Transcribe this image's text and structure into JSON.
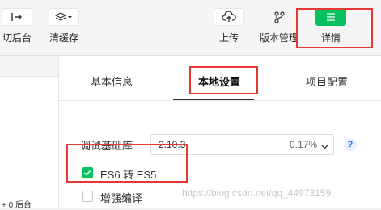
{
  "toolbar": {
    "switch_background": {
      "label": "切后台",
      "icon": "switch-background-icon"
    },
    "clear_cache": {
      "label": "清缓存",
      "icon": "layers-dropdown-icon"
    },
    "upload": {
      "label": "上传",
      "icon": "cloud-upload-icon"
    },
    "version_management": {
      "label": "版本管理",
      "icon": "branch-icon"
    },
    "details": {
      "label": "详情",
      "icon": "menu-icon",
      "active": true
    }
  },
  "left_fragment": "+ 0 后台",
  "panel": {
    "tabs": [
      {
        "label": "基本信息"
      },
      {
        "label": "本地设置",
        "active": true
      },
      {
        "label": "项目配置"
      }
    ],
    "base_library": {
      "label": "调试基础库",
      "version": "2.10.3",
      "percent": "0.17%",
      "help": "?"
    },
    "options": [
      {
        "label": "ES6 转 ES5",
        "checked": true
      },
      {
        "label": "增强编译",
        "checked": false
      }
    ]
  },
  "watermark": "https://blog.csdn.net/qq_44973159",
  "colors": {
    "accent": "#07c160",
    "annotation": "#e53935",
    "link": "#2f6be5"
  }
}
